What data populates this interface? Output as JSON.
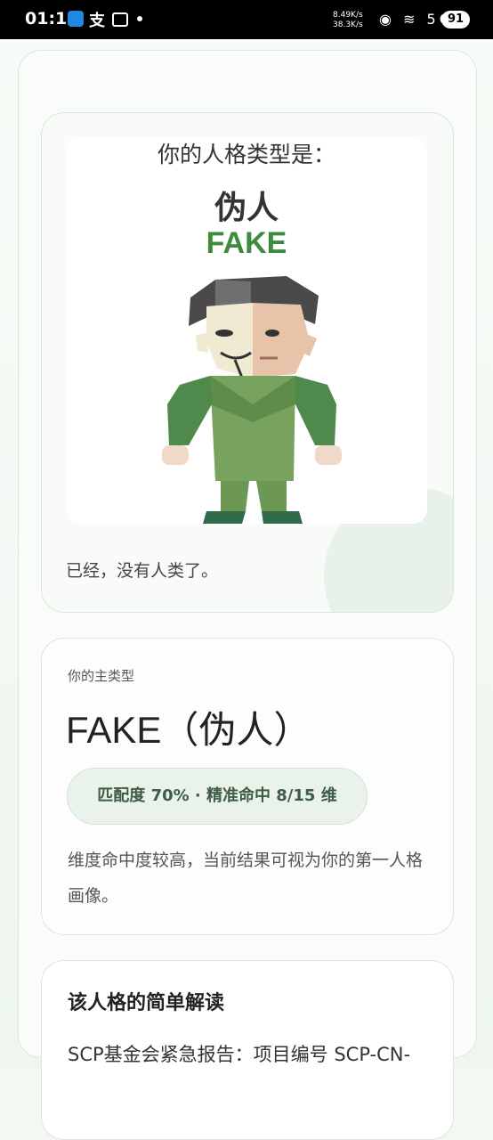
{
  "status_bar": {
    "time": "01:19",
    "pay_icon": "支",
    "speed_up": "8.49K/s",
    "speed_down": "38.3K/s",
    "icons": "◉ ≋ 5G",
    "battery": "91"
  },
  "hero": {
    "heading": "你的人格类型是：",
    "cn_name": "伪人",
    "en_name": "FAKE",
    "caption": "已经，没有人类了。"
  },
  "type_card": {
    "label": "你的主类型",
    "title": "FAKE（伪人）",
    "match_text": "匹配度 70% · 精准命中 8/15 维",
    "description": "维度命中度较高，当前结果可视为你的第一人格画像。"
  },
  "reading": {
    "title": "该人格的简单解读",
    "body": "SCP基金会紧急报告：项目编号 SCP-CN-"
  },
  "colors": {
    "accent_green": "#3d8b3d",
    "card_border": "#dbe6db",
    "pill_bg": "#eaf3eb"
  }
}
